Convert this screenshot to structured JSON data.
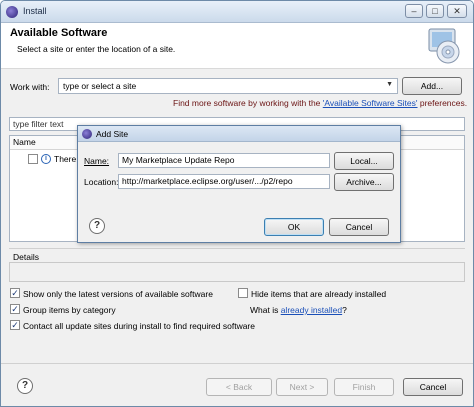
{
  "window": {
    "title": "Install",
    "controls": {
      "minimize": "–",
      "maximize": "□",
      "close": "✕"
    }
  },
  "header": {
    "title": "Available Software",
    "subtitle": "Select a site or enter the location of a site."
  },
  "work_with": {
    "label": "Work with:",
    "value": "type or select a site",
    "add_button": "Add..."
  },
  "find_more": {
    "prefix": "Find more software by working with the ",
    "link": "'Available Software Sites'",
    "suffix": " preferences."
  },
  "filter": {
    "placeholder": "type filter text"
  },
  "list": {
    "column_name": "Name",
    "items": [
      {
        "label": "There i"
      }
    ]
  },
  "details": {
    "label": "Details"
  },
  "options": {
    "show_latest": {
      "label": "Show only the latest versions of available software",
      "checked": true
    },
    "hide_installed": {
      "label": "Hide items that are already installed",
      "checked": false
    },
    "group_by_category": {
      "label": "Group items by category",
      "checked": true
    },
    "what_is": {
      "prefix": "What is ",
      "link": "already installed",
      "suffix": "?"
    },
    "contact_sites": {
      "label": "Contact all update sites during install to find required software",
      "checked": true
    }
  },
  "footer": {
    "back": "< Back",
    "next": "Next >",
    "finish": "Finish",
    "cancel": "Cancel"
  },
  "add_site_dialog": {
    "title": "Add Site",
    "name_label": "Name:",
    "name_value": "My Marketplace Update Repo",
    "local_button": "Local...",
    "location_label": "Location:",
    "location_value": "http://marketplace.eclipse.org/user/.../p2/repo",
    "archive_button": "Archive...",
    "ok_button": "OK",
    "cancel_button": "Cancel"
  },
  "icons": {
    "help": "?",
    "info": "i",
    "check": "✓",
    "dropdown": "▼"
  }
}
